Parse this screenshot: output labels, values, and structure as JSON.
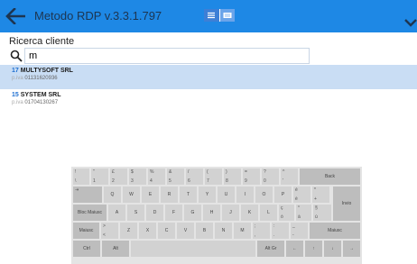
{
  "header": {
    "title": "Metodo RDP v.3.3.1.797",
    "colors": {
      "bar": "#1e88e5",
      "title_text": "#1d3551"
    }
  },
  "search": {
    "label": "Ricerca cliente",
    "value": "m"
  },
  "results": [
    {
      "code": "17",
      "name": "MULTYSOFT SRL",
      "piva_prefix": "p.iva",
      "piva": "01131620936",
      "selected": true
    },
    {
      "code": "15",
      "name": "SYSTEM SRL",
      "piva_prefix": "p.iva",
      "piva": "01704130267",
      "selected": false
    }
  ],
  "keyboard": {
    "row1": [
      {
        "top": "!",
        "bottom": "\\"
      },
      {
        "top": "\"",
        "bottom": "1"
      },
      {
        "top": "£",
        "bottom": "2"
      },
      {
        "top": "$",
        "bottom": "3"
      },
      {
        "top": "%",
        "bottom": "4"
      },
      {
        "top": "&",
        "bottom": "5"
      },
      {
        "top": "/",
        "bottom": "6"
      },
      {
        "top": "(",
        "bottom": "7"
      },
      {
        "top": ")",
        "bottom": "8"
      },
      {
        "top": "=",
        "bottom": "9"
      },
      {
        "top": "?",
        "bottom": "0"
      },
      {
        "top": "^",
        "bottom": "'"
      }
    ],
    "back_label": "Back",
    "tab_label": "⇥",
    "row2": [
      "Q",
      "W",
      "E",
      "R",
      "T",
      "Y",
      "U",
      "I",
      "O",
      "P"
    ],
    "bracket_keys": [
      {
        "top": "é",
        "bottom": "è"
      },
      {
        "top": "*",
        "bottom": "+"
      }
    ],
    "invio_label": "Invio",
    "bloc_label": "Bloc Maiusc",
    "row3": [
      "A",
      "S",
      "D",
      "F",
      "G",
      "H",
      "J",
      "K",
      "L"
    ],
    "semi_keys": [
      {
        "top": "ç",
        "bottom": "ò"
      },
      {
        "top": "°",
        "bottom": "à"
      },
      {
        "top": "§",
        "bottom": "ù"
      }
    ],
    "shift_label": "Maiusc",
    "angle_key": {
      "top": ">",
      "bottom": "<"
    },
    "row4": [
      "Z",
      "X",
      "C",
      "V",
      "B",
      "N",
      "M"
    ],
    "punct_keys": [
      {
        "top": ";",
        "bottom": ","
      },
      {
        "top": ":",
        "bottom": "."
      },
      {
        "top": "_",
        "bottom": "-"
      }
    ],
    "shift_right_label": "Maiusc",
    "ctrl_label": "Ctrl",
    "alt_label": "Alt",
    "altgr_label": "Alt Gr",
    "arrows": [
      "←",
      "↑",
      "↓",
      "→"
    ]
  }
}
